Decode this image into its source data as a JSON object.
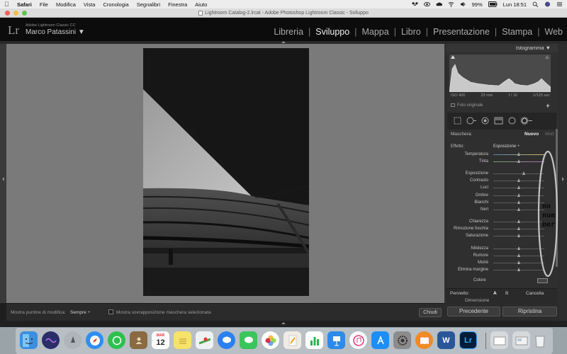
{
  "menubar": {
    "app": "Safari",
    "items": [
      "File",
      "Modifica",
      "Vista",
      "Cronologia",
      "Segnalibri",
      "Finestra",
      "Aiuto"
    ],
    "battery": "99%",
    "clock": "Lun 18:51"
  },
  "window": {
    "title": "Lightroom Catalog-2.lrcat - Adobe Photoshop Lightroom Classic - Sviluppo"
  },
  "lr_header": {
    "logo": "Lr",
    "app_name": "Adobe Lightroom Classic CC",
    "user_name": "Marco Patassini ▼",
    "modules": [
      "Libreria",
      "Sviluppo",
      "Mappa",
      "Libro",
      "Presentazione",
      "Stampa",
      "Web"
    ],
    "active_module": "Sviluppo"
  },
  "histogram": {
    "title": "Istogramma ▼",
    "iso": "ISO 400",
    "focal": "23 mm",
    "aperture": "f / 16",
    "shutter": "1/125 sec",
    "original_label": "Foto originale"
  },
  "mask": {
    "label": "Maschera:",
    "new_label": "Nuovo",
    "mod_label": "Mod"
  },
  "effect": {
    "label": "Effetto:",
    "value": "Esposizione ÷"
  },
  "sliders": [
    {
      "label": "Temperatura",
      "value": 0.5
    },
    {
      "label": "Tinta",
      "value": 0.5
    },
    {
      "label": "Esposizione",
      "value": 0.6
    },
    {
      "label": "Contrasto",
      "value": 0.5
    },
    {
      "label": "Luci",
      "value": 0.5
    },
    {
      "label": "Ombre",
      "value": 0.5
    },
    {
      "label": "Bianchi",
      "value": 0.5
    },
    {
      "label": "Neri",
      "value": 0.5
    },
    {
      "label": "Chiarezza",
      "value": 0.5
    },
    {
      "label": "Rimozione foschia",
      "value": 0.5
    },
    {
      "label": "Saturazione",
      "value": 0.5
    },
    {
      "label": "Nitidezza",
      "value": 0.5
    },
    {
      "label": "Rumore",
      "value": 0.5
    },
    {
      "label": "Moiré",
      "value": 0.5
    },
    {
      "label": "Elimina margine",
      "value": 0.5
    }
  ],
  "color_label": "Colore",
  "brush": {
    "label": "Pennello:",
    "a": "A",
    "b": "B",
    "cancel": "Cancella",
    "size_label": "Dimensione"
  },
  "annotation_text": "no\nnum\nber",
  "toolbar": {
    "show_pins_label": "Mostra puntine di modifica:",
    "show_pins_value": "Sempre ÷",
    "overlay_label": "Mostra sovrapposizione maschera selezionata",
    "close_label": "Chiudi"
  },
  "buttons": {
    "previous": "Precedente",
    "reset": "Ripristina"
  },
  "dock": {
    "calendar_month": "MAR",
    "calendar_day": "12",
    "word_letter": "W",
    "lr_letter": "Lr"
  }
}
